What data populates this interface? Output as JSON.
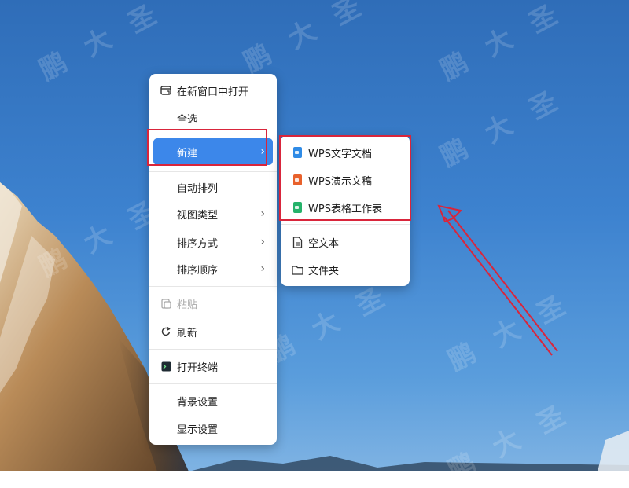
{
  "watermark_text": "鹏大圣",
  "context_menu": {
    "items": [
      {
        "label": "在新窗口中打开",
        "icon": "open-window-icon"
      },
      {
        "label": "全选"
      },
      {
        "label": "新建",
        "submenu_arrow": "›",
        "state": "highlighted"
      },
      {
        "label": "自动排列"
      },
      {
        "label": "视图类型",
        "submenu_arrow": "›"
      },
      {
        "label": "排序方式",
        "submenu_arrow": "›"
      },
      {
        "label": "排序顺序",
        "submenu_arrow": "›"
      },
      {
        "label": "粘贴",
        "icon": "paste-icon",
        "state": "disabled"
      },
      {
        "label": "刷新",
        "icon": "refresh-icon"
      },
      {
        "label": "打开终端",
        "icon": "terminal-icon"
      },
      {
        "label": "背景设置"
      },
      {
        "label": "显示设置"
      }
    ]
  },
  "new_submenu": {
    "items": [
      {
        "label": "WPS文字文档",
        "icon": "wps-writer-icon",
        "color": "#2f8be6"
      },
      {
        "label": "WPS演示文稿",
        "icon": "wps-presentation-icon",
        "color": "#e8612c"
      },
      {
        "label": "WPS表格工作表",
        "icon": "wps-spreadsheet-icon",
        "color": "#25b26a"
      },
      {
        "label": "空文本",
        "icon": "text-file-icon"
      },
      {
        "label": "文件夹",
        "icon": "folder-icon"
      }
    ]
  },
  "colors": {
    "highlight": "#3c87ea",
    "annotation_red": "#d9253b",
    "sky": "#3d82cf"
  }
}
